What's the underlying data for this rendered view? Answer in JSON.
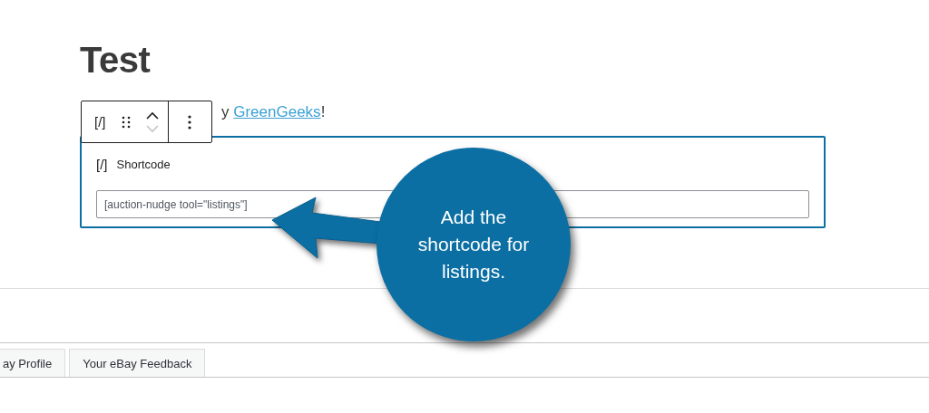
{
  "title": "Test",
  "paragraph": {
    "text_before": "y ",
    "link": "GreenGeeks",
    "text_after": "!"
  },
  "block_toolbar": {
    "items": [
      {
        "kind": "block-type",
        "label": "[/]"
      },
      {
        "kind": "drag"
      },
      {
        "kind": "move"
      },
      {
        "kind": "more"
      }
    ]
  },
  "shortcode_block": {
    "icon": "[/]",
    "label": "Shortcode",
    "value": "[auction-nudge tool=\"listings\"]"
  },
  "callout": {
    "text": "Add the shortcode for listings."
  },
  "tabs": [
    {
      "label": "ay Profile"
    },
    {
      "label": "Your eBay Feedback"
    }
  ]
}
